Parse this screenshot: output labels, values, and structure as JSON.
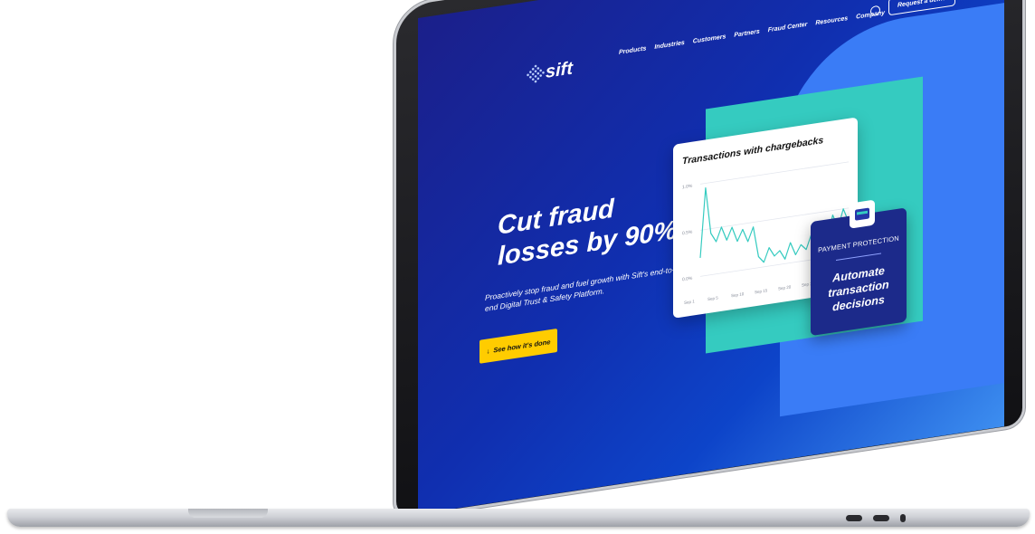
{
  "nav": {
    "logo_text": "sift",
    "links": [
      "Products",
      "Industries",
      "Customers",
      "Partners",
      "Fraud Center",
      "Resources",
      "Company"
    ],
    "demo_button": "Request a demo"
  },
  "hero": {
    "title": "Cut fraud losses by 90%",
    "subtitle": "Proactively stop fraud and fuel growth with Sift's end-to-end Digital Trust & Safety Platform.",
    "cta_label": "See how it's done",
    "cta_icon": "arrow-down-icon"
  },
  "chart_card": {
    "title": "Transactions with chargebacks"
  },
  "payment_card": {
    "label": "PAYMENT PROTECTION",
    "heading": "Automate transaction decisions",
    "icon": "credit-card-icon"
  },
  "chart_data": {
    "type": "line",
    "title": "Transactions with chargebacks",
    "y_ticks": [
      "1.0%",
      "0.5%",
      "0.0%"
    ],
    "x_ticks": [
      "Sep 1",
      "Sep 5",
      "Sep 10",
      "Sep 15",
      "Sep 20",
      "Sep 25",
      "Se"
    ],
    "x": [
      0,
      1,
      2,
      3,
      4,
      5,
      6,
      7,
      8,
      9,
      10,
      11,
      12,
      13,
      14,
      15,
      16,
      17,
      18,
      19,
      20,
      21,
      22,
      23,
      24,
      25,
      26,
      27,
      28
    ],
    "values": [
      0.2,
      0.95,
      0.45,
      0.35,
      0.5,
      0.35,
      0.48,
      0.32,
      0.44,
      0.3,
      0.45,
      0.12,
      0.05,
      0.2,
      0.1,
      0.15,
      0.05,
      0.22,
      0.08,
      0.18,
      0.12,
      0.28,
      0.1,
      0.32,
      0.2,
      0.45,
      0.3,
      0.5,
      0.35
    ],
    "ylim": [
      0,
      1.0
    ],
    "grid": true,
    "color": "#35cbc0"
  },
  "colors": {
    "hero_bg": "#102fb0",
    "accent_teal": "#35cbc0",
    "cta_yellow": "#ffcc00",
    "card_navy": "#1c2a8a"
  }
}
